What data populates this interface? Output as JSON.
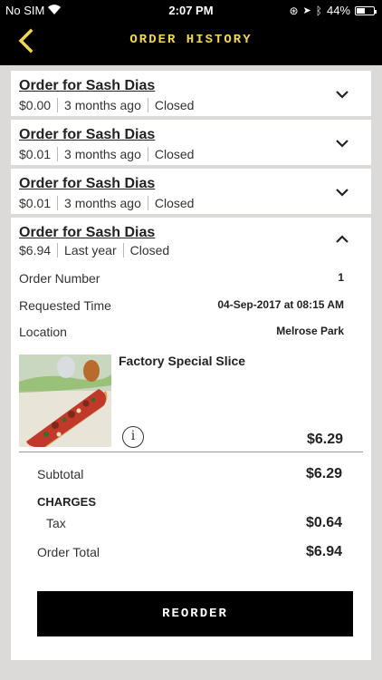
{
  "status_bar": {
    "carrier": "No SIM",
    "time": "2:07 PM",
    "battery": "44%",
    "battery_level": 0.44
  },
  "header": {
    "title": "ORDER HISTORY",
    "accent_color": "#f2d64b",
    "back_icon": "chevron-left-icon"
  },
  "orders": [
    {
      "title": "Order for Sash Dias",
      "amount": "$0.00",
      "when": "3 months ago",
      "status": "Closed",
      "expanded": false
    },
    {
      "title": "Order for Sash Dias",
      "amount": "$0.01",
      "when": "3 months ago",
      "status": "Closed",
      "expanded": false
    },
    {
      "title": "Order for Sash Dias",
      "amount": "$0.01",
      "when": "3 months ago",
      "status": "Closed",
      "expanded": false
    },
    {
      "title": "Order for Sash Dias",
      "amount": "$6.94",
      "when": "Last year",
      "status": "Closed",
      "expanded": true
    }
  ],
  "detail": {
    "order_number_label": "Order Number",
    "order_number": "1",
    "requested_time_label": "Requested Time",
    "requested_time": "04-Sep-2017 at 08:15 AM",
    "location_label": "Location",
    "location": "Melrose Park",
    "item": {
      "name": "Factory Special Slice",
      "price": "$6.29",
      "info_icon": "info-icon"
    },
    "subtotal_label": "Subtotal",
    "subtotal": "$6.29",
    "charges_label": "CHARGES",
    "tax_label": "Tax",
    "tax": "$0.64",
    "total_label": "Order Total",
    "total": "$6.94",
    "reorder_label": "REORDER"
  }
}
